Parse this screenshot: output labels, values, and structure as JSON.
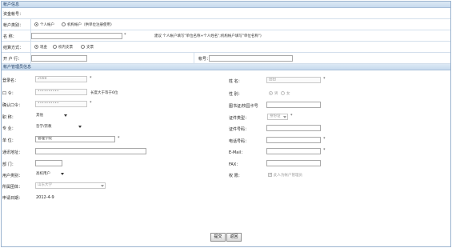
{
  "account_section": {
    "title": "帐户信息",
    "fund_account": {
      "label": "资金帐号："
    },
    "account_type": {
      "label": "帐户类别：",
      "options": [
        "个人帐户",
        "机构帐户（供单位注册使用）"
      ],
      "selected": 0
    },
    "name": {
      "label": "名 称：",
      "value": "",
      "hint": "建议 个人帐户填写\"单位名称+个人姓名\";机构帐户填写\"单位名称\")"
    },
    "settle_method": {
      "label": "结算方式：",
      "options": [
        "现金",
        "校内支票",
        "支票"
      ],
      "selected": 0
    },
    "bank": {
      "label": "开 户 行：",
      "value": ""
    },
    "account_no": {
      "label": "帐号：",
      "value": ""
    }
  },
  "manager_section": {
    "title": "帐户管理员信息",
    "login_name": {
      "label": "登录名：",
      "value": "2088"
    },
    "password": {
      "label": "口 令：",
      "value": "••••••••••",
      "hint": "长度大于等于6位"
    },
    "confirm_password": {
      "label": "确认口令：",
      "value": "••••••••••"
    },
    "title_field": {
      "label": "职 称：",
      "value": "其他"
    },
    "major": {
      "label": "专 业：",
      "value": "哲学/宗教"
    },
    "unit": {
      "label": "单 位：",
      "value": "管理学院"
    },
    "address": {
      "label": "通讯地址：",
      "value": ""
    },
    "department": {
      "label": "部 门：",
      "value": ""
    },
    "user_category": {
      "label": "用户类别：",
      "value": "高校用户"
    },
    "affiliation": {
      "label": "所属团体：",
      "value": "山东大学"
    },
    "apply_date": {
      "label": "申请日期：",
      "value": "2012-4-9"
    },
    "real_name": {
      "label": "姓 名：",
      "value": "田田"
    },
    "gender": {
      "label": "性 别：",
      "options": [
        "男",
        "女"
      ],
      "selected": 0
    },
    "library_card": {
      "label": "图书证/校园卡号",
      "value": ""
    },
    "id_type": {
      "label": "证件类型：",
      "value": "身份证"
    },
    "id_number": {
      "label": "证件号码：",
      "value": ""
    },
    "phone": {
      "label": "电话号码：",
      "value": ""
    },
    "email": {
      "label": "E-Mail：",
      "value": ""
    },
    "fax": {
      "label": "FAX：",
      "value": ""
    },
    "permission": {
      "label": "权 限：",
      "checkbox_label": "此人为帐户管理员",
      "checked": true
    }
  },
  "actions": {
    "submit": "提交",
    "back": "返回"
  }
}
